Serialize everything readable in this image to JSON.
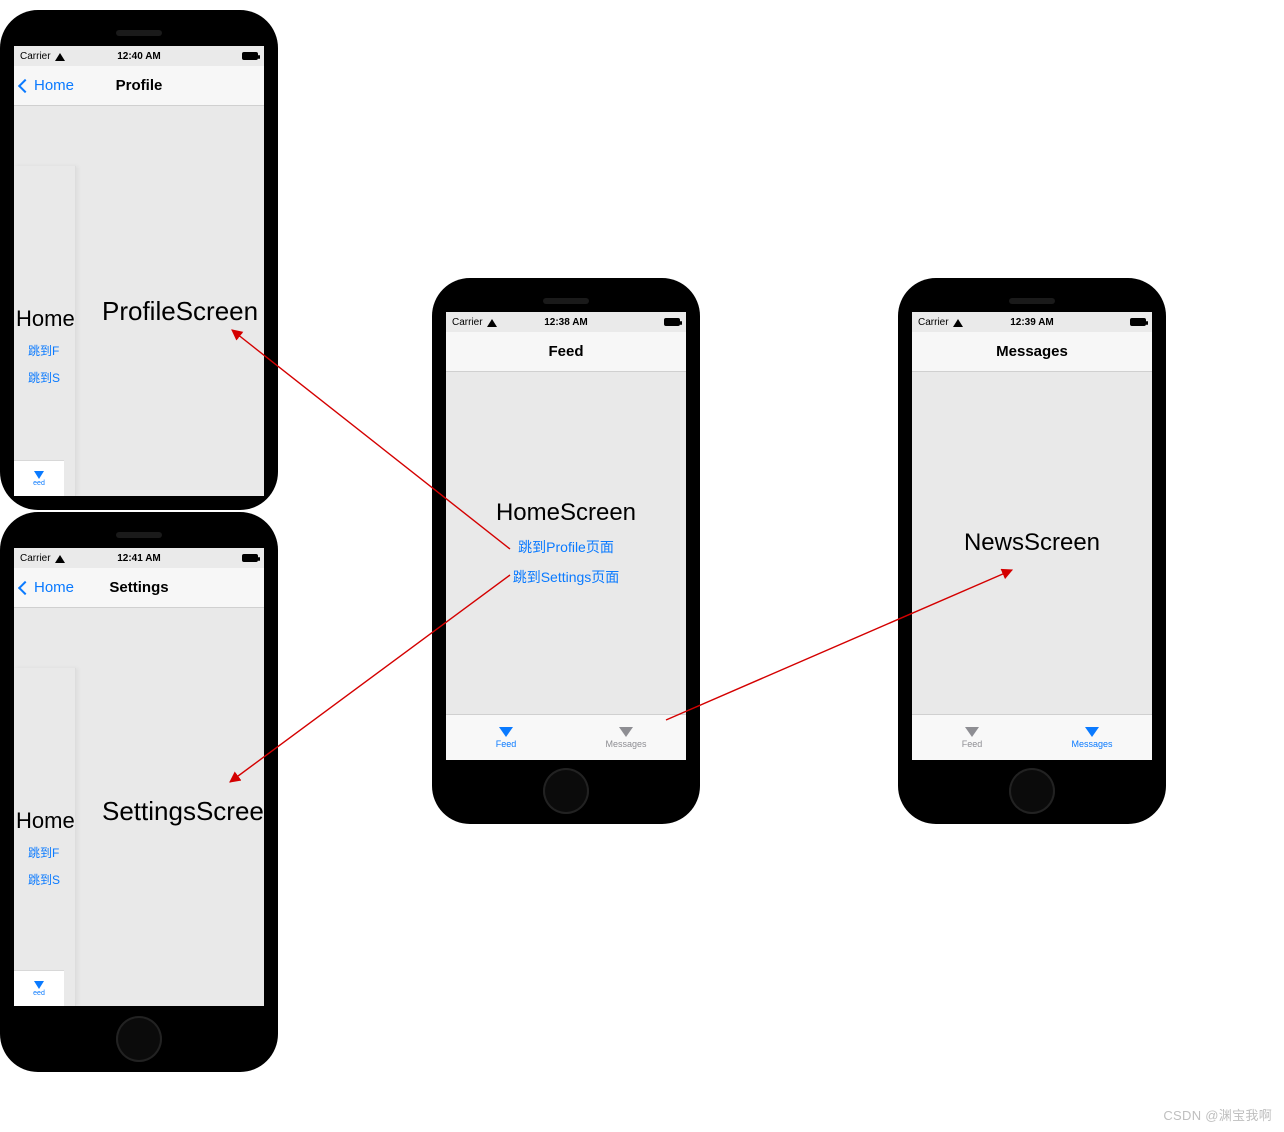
{
  "watermark": "CSDN @渊宝我啊",
  "phones": {
    "profile": {
      "carrier": "Carrier",
      "time": "12:40 AM",
      "back_label": "Home",
      "nav_title": "Profile",
      "screen_title": "ProfileScreen",
      "sliver_title": "Home",
      "sliver_link1": "跳到F",
      "sliver_link2": "跳到S",
      "sliver_tab": "eed"
    },
    "settings": {
      "carrier": "Carrier",
      "time": "12:41 AM",
      "back_label": "Home",
      "nav_title": "Settings",
      "screen_title": "SettingsScree",
      "sliver_title": "Home",
      "sliver_link1": "跳到F",
      "sliver_link2": "跳到S",
      "sliver_tab": "eed"
    },
    "feed": {
      "carrier": "Carrier",
      "time": "12:38 AM",
      "nav_title": "Feed",
      "screen_title": "HomeScreen",
      "link1": "跳到Profile页面",
      "link2": "跳到Settings页面",
      "tab1": "Feed",
      "tab2": "Messages"
    },
    "messages": {
      "carrier": "Carrier",
      "time": "12:39 AM",
      "nav_title": "Messages",
      "screen_title": "NewsScreen",
      "tab1": "Feed",
      "tab2": "Messages"
    }
  },
  "colors": {
    "ios_blue": "#0a7aff",
    "inactive_gray": "#8e8e93"
  }
}
